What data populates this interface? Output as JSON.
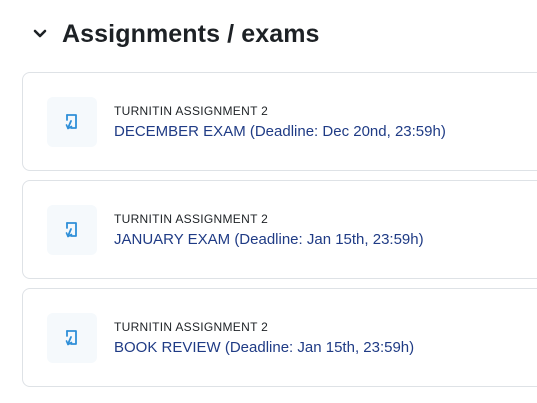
{
  "section": {
    "title": "Assignments / exams",
    "expanded": true
  },
  "activities": [
    {
      "type_label": "TURNITIN ASSIGNMENT 2",
      "name": "DECEMBER EXAM (Deadline: Dec 20nd, 23:59h)",
      "icon": "turnitin-icon"
    },
    {
      "type_label": "TURNITIN ASSIGNMENT 2",
      "name": "JANUARY EXAM (Deadline: Jan 15th, 23:59h)",
      "icon": "turnitin-icon"
    },
    {
      "type_label": "TURNITIN ASSIGNMENT 2",
      "name": "BOOK REVIEW (Deadline: Jan 15th, 23:59h)",
      "icon": "turnitin-icon"
    }
  ],
  "colors": {
    "title": "#1d2125",
    "link": "#1f3b85",
    "icon": "#2f8fd8",
    "icon_bg": "#f5f9fc",
    "card_border": "#dee2e6"
  }
}
